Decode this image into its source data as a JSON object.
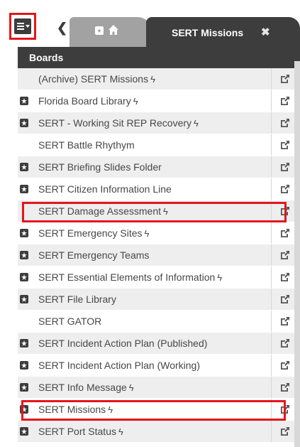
{
  "toolbar": {
    "menu_icon": "hamburger-menu-icon",
    "back_icon": "chevron-left-icon",
    "tabs": [
      {
        "label": "",
        "icons": [
          "board-icon",
          "home-icon"
        ],
        "active": false
      },
      {
        "label": "SERT Missions",
        "active": true,
        "close_label": "✖"
      }
    ]
  },
  "panel": {
    "title": "Boards",
    "items": [
      {
        "label": "(Archive) SERT Missions",
        "board_icon": false,
        "bolt": true,
        "highlighted": false
      },
      {
        "label": "Florida Board Library",
        "board_icon": true,
        "bolt": true,
        "highlighted": false
      },
      {
        "label": "SERT - Working Sit REP Recovery",
        "board_icon": true,
        "bolt": true,
        "highlighted": false
      },
      {
        "label": "SERT Battle Rhythym",
        "board_icon": false,
        "bolt": false,
        "highlighted": false
      },
      {
        "label": "SERT Briefing Slides Folder",
        "board_icon": true,
        "bolt": false,
        "highlighted": false
      },
      {
        "label": "SERT Citizen Information Line",
        "board_icon": true,
        "bolt": false,
        "highlighted": false
      },
      {
        "label": "SERT Damage Assessment",
        "board_icon": false,
        "bolt": true,
        "highlighted": true
      },
      {
        "label": "SERT Emergency Sites",
        "board_icon": true,
        "bolt": true,
        "highlighted": false
      },
      {
        "label": "SERT Emergency Teams",
        "board_icon": true,
        "bolt": false,
        "highlighted": false
      },
      {
        "label": "SERT Essential Elements of Information",
        "board_icon": true,
        "bolt": true,
        "highlighted": false
      },
      {
        "label": "SERT File Library",
        "board_icon": true,
        "bolt": false,
        "highlighted": false
      },
      {
        "label": "SERT GATOR",
        "board_icon": false,
        "bolt": false,
        "highlighted": false
      },
      {
        "label": "SERT Incident Action Plan (Published)",
        "board_icon": true,
        "bolt": false,
        "highlighted": false
      },
      {
        "label": "SERT Incident Action Plan (Working)",
        "board_icon": true,
        "bolt": false,
        "highlighted": false
      },
      {
        "label": "SERT Info Message",
        "board_icon": true,
        "bolt": true,
        "highlighted": false
      },
      {
        "label": "SERT Missions",
        "board_icon": true,
        "bolt": true,
        "highlighted": true
      },
      {
        "label": "SERT Port Status",
        "board_icon": true,
        "bolt": true,
        "highlighted": false
      }
    ],
    "bolt_glyph": "ϟ",
    "open_icon": "open-in-new-icon"
  },
  "colors": {
    "highlight": "#e3161b",
    "header_bg": "#3d3d3d",
    "row_alt_bg": "#eeeeee",
    "inactive_tab_bg": "#a2a2a2"
  }
}
